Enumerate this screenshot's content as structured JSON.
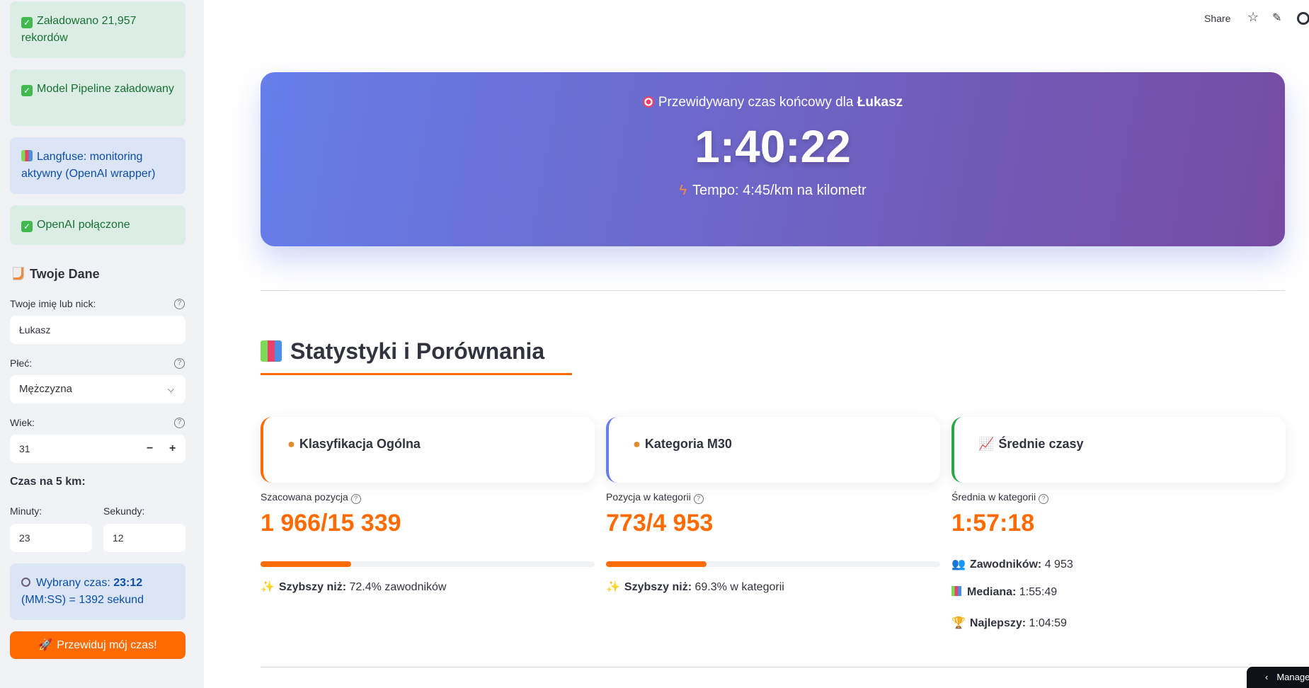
{
  "sidebar": {
    "alerts": [
      {
        "text": "Załadowano 21,957 rekordów",
        "icon": "check-icon"
      },
      {
        "text": "Model Pipeline załadowany",
        "icon": "check-icon"
      },
      {
        "text": "Langfuse: monitoring aktywny (OpenAI wrapper)",
        "icon": "bar-chart-icon"
      },
      {
        "text": "OpenAI połączone",
        "icon": "check-icon"
      }
    ],
    "section_title": "Twoje Dane",
    "name_label": "Twoje imię lub nick:",
    "name_value": "Łukasz",
    "gender_label": "Płeć:",
    "gender_value": "Mężczyzna",
    "age_label": "Wiek:",
    "age_value": "31",
    "minus": "−",
    "plus": "+",
    "time_title": "Czas na 5 km:",
    "minutes_label": "Minuty:",
    "minutes_value": "23",
    "seconds_label": "Sekundy:",
    "seconds_value": "12",
    "selected_prefix": "Wybrany czas: ",
    "selected_time": "23:12",
    "selected_suffix": "(MM:SS) = 1392 sekund",
    "predict_button": "Przewiduj mój czas!"
  },
  "header": {
    "share": "Share"
  },
  "banner": {
    "prefix": "Przewidywany czas końcowy dla ",
    "name": "Łukasz",
    "time": "1:40:22",
    "pace": "Tempo: 4:45/km na kilometr"
  },
  "stats": {
    "title": "Statystyki i Porównania",
    "cards": [
      {
        "title": "Klasyfikacja Ogólna",
        "label": "Szacowana pozycja",
        "value": "1 966/15 339",
        "progress": 0.272,
        "note_bold": "Szybszy niż:",
        "note": " 72.4% zawodników",
        "accent": "#ff6b00"
      },
      {
        "title": "Kategoria M30",
        "label": "Pozycja w kategorii",
        "value": "773/4 953",
        "progress": 0.3,
        "note_bold": "Szybszy niż:",
        "note": " 69.3% w kategorii",
        "accent": "#667eea"
      },
      {
        "title": "Średnie czasy",
        "label": "Średnia w kategorii",
        "value": "1:57:18",
        "accent": "#28a745"
      }
    ],
    "extra": [
      {
        "bold": "Zawodników:",
        "value": " 4 953"
      },
      {
        "bold": "Mediana:",
        "value": " 1:55:49"
      },
      {
        "bold": "Najlepszy:",
        "value": " 1:04:59"
      }
    ]
  },
  "manage": "Manage app"
}
